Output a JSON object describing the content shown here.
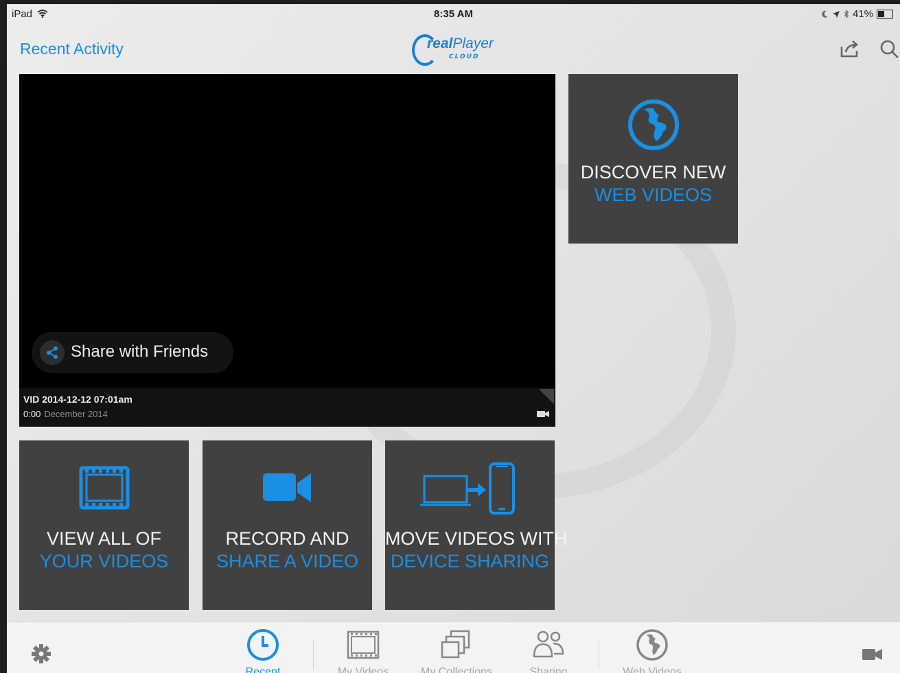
{
  "status_bar": {
    "device": "iPad",
    "time": "8:35 AM",
    "battery": "41%"
  },
  "header": {
    "recent_link": "Recent Activity",
    "logo_real": "real",
    "logo_player": "Player",
    "logo_sub": "CLOUD"
  },
  "video": {
    "share_label": "Share with Friends",
    "title": "VID 2014-12-12 07:01am",
    "duration": "0:00",
    "date": "December 2014"
  },
  "tiles": {
    "discover": {
      "line1": "DISCOVER NEW",
      "line2": "WEB VIDEOS",
      "icon": "globe-icon"
    },
    "view_all": {
      "line1": "VIEW ALL OF",
      "line2": "YOUR VIDEOS",
      "icon": "film-icon"
    },
    "record": {
      "line1": "RECORD AND",
      "line2": "SHARE A VIDEO",
      "icon": "video-camera-icon"
    },
    "move": {
      "line1": "MOVE VIDEOS WITH",
      "line2": "DEVICE SHARING",
      "icon": "device-transfer-icon"
    }
  },
  "tab_bar": {
    "tabs": [
      {
        "label": "Recent",
        "icon": "clock-icon",
        "active": true
      },
      {
        "label": "My Videos",
        "icon": "film-icon",
        "active": false
      },
      {
        "label": "My Collections",
        "icon": "collections-icon",
        "active": false
      },
      {
        "label": "Sharing",
        "icon": "people-icon",
        "active": false
      },
      {
        "label": "Web Videos",
        "icon": "globe-icon",
        "active": false
      }
    ]
  },
  "colors": {
    "accent": "#1a8fe3",
    "tile_background": "#414141",
    "tab_inactive": "#a5a5a5"
  }
}
